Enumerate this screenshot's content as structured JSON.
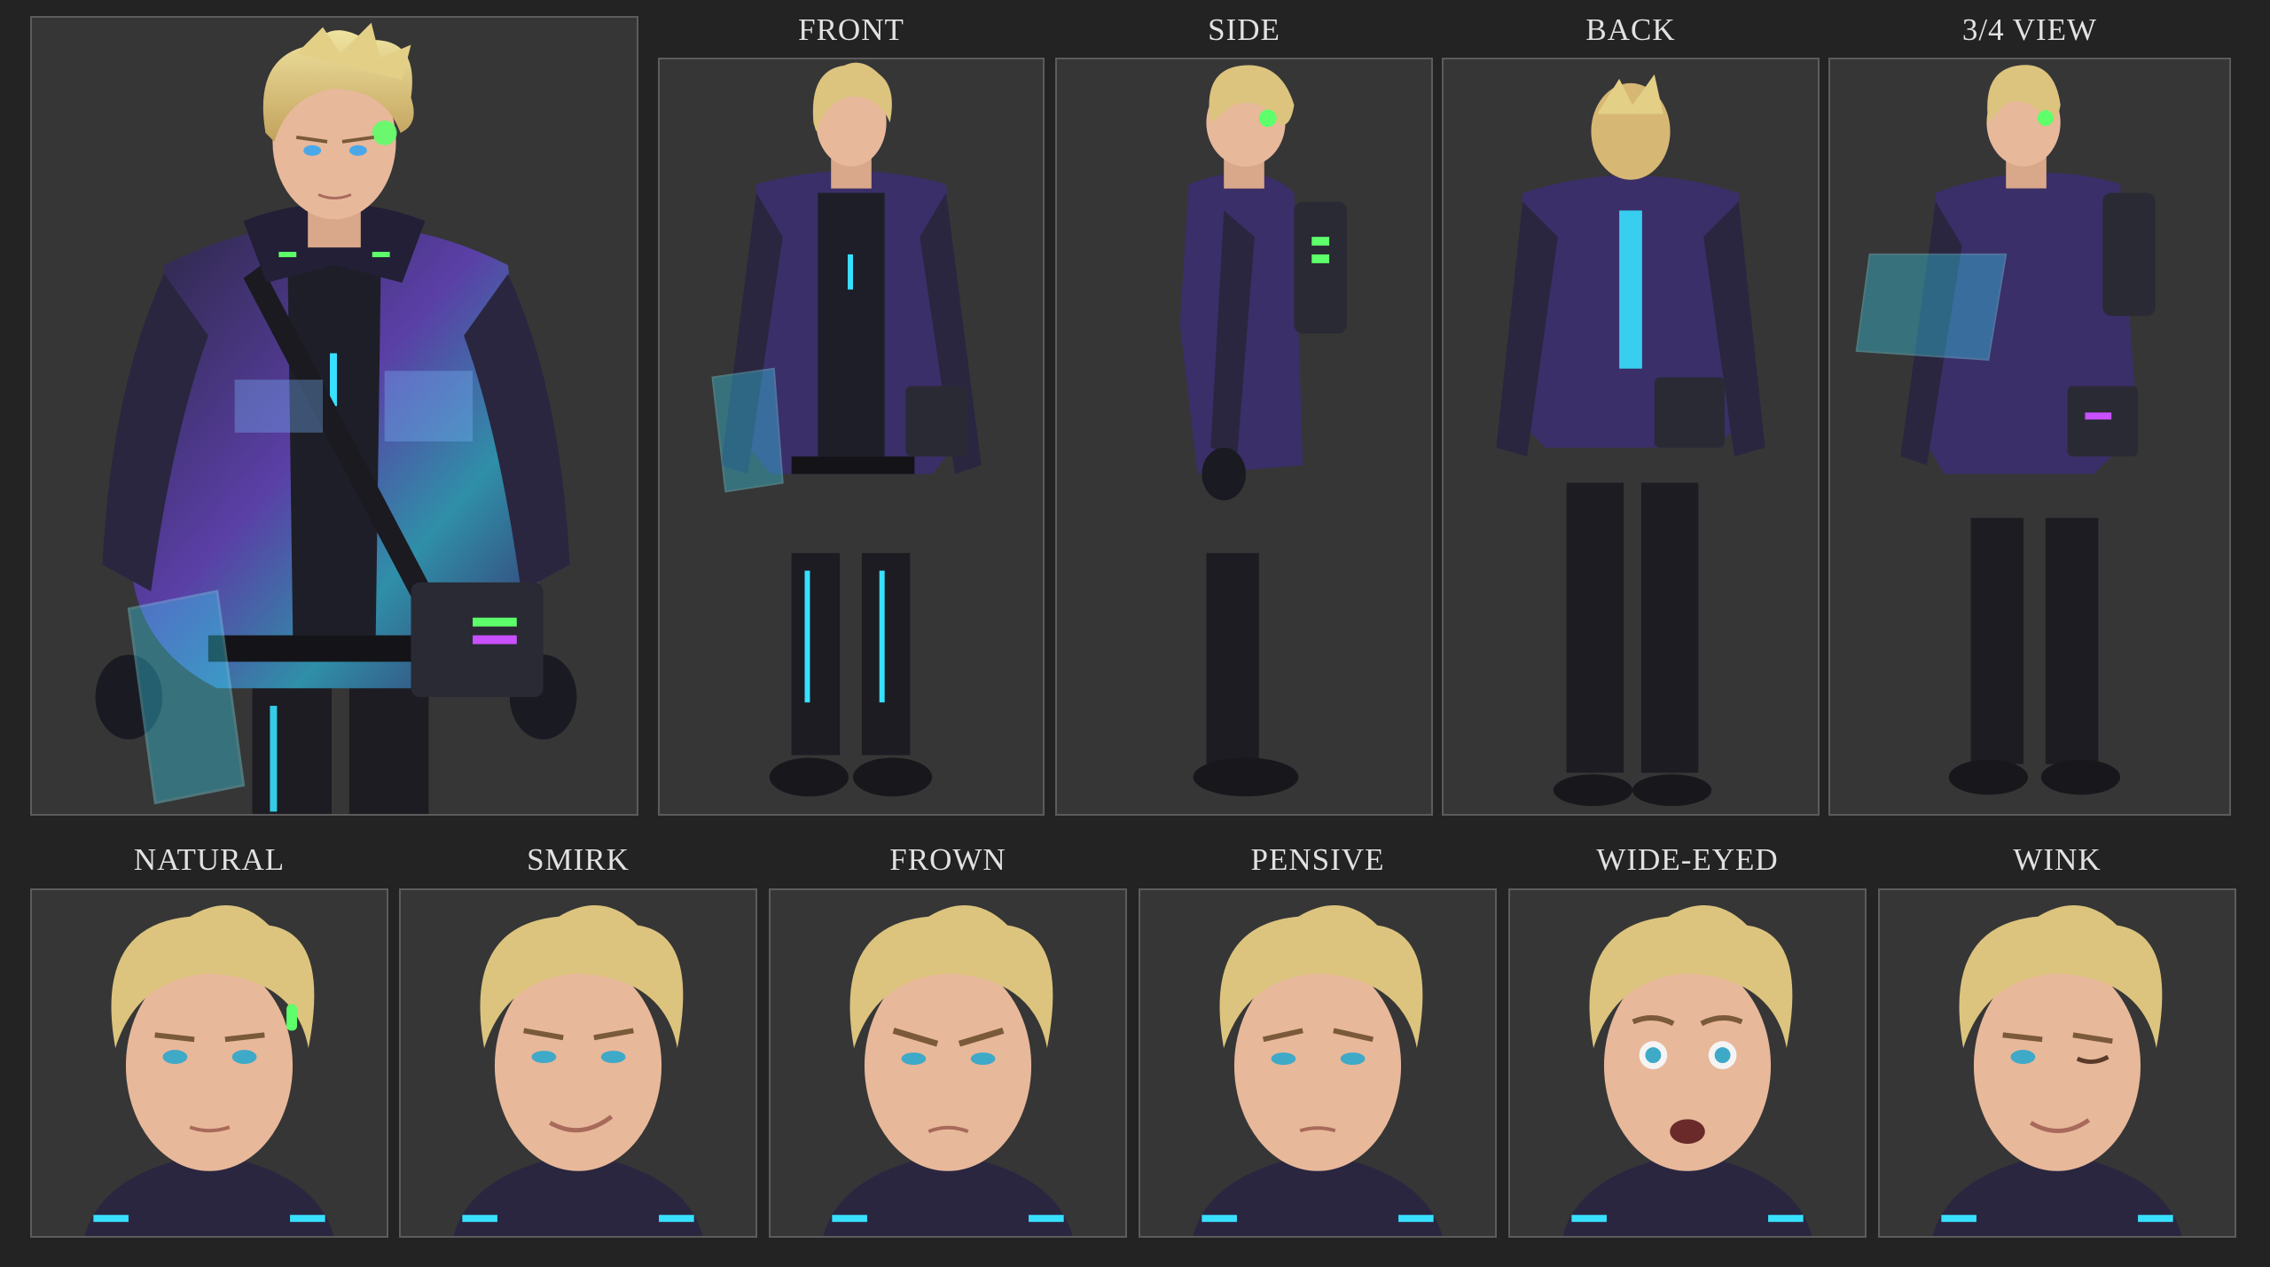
{
  "views": [
    {
      "id": "front",
      "label": "FRONT"
    },
    {
      "id": "side",
      "label": "SIDE"
    },
    {
      "id": "back",
      "label": "BACK"
    },
    {
      "id": "three-quarter",
      "label": "3/4 VIEW"
    }
  ],
  "expressions": [
    {
      "id": "natural",
      "label": "NATURAL"
    },
    {
      "id": "smirk",
      "label": "SMIRK"
    },
    {
      "id": "frown",
      "label": "FROWN"
    },
    {
      "id": "pensive",
      "label": "PENSIVE"
    },
    {
      "id": "wide-eyed",
      "label": "WIDE-EYED"
    },
    {
      "id": "wink",
      "label": "WINK"
    }
  ],
  "colors": {
    "background": "#232323",
    "panel": "#363636",
    "panel_border": "#5c5c5c",
    "label": "#e2e2e2",
    "hair": "#d9c27a",
    "hair_highlight": "#a8d88a",
    "skin": "#e8b89a",
    "jacket": "#2a2640",
    "jacket_iridescent": "#7a4fd0",
    "neon_cyan": "#38e0ff",
    "neon_green": "#5dff6a"
  }
}
